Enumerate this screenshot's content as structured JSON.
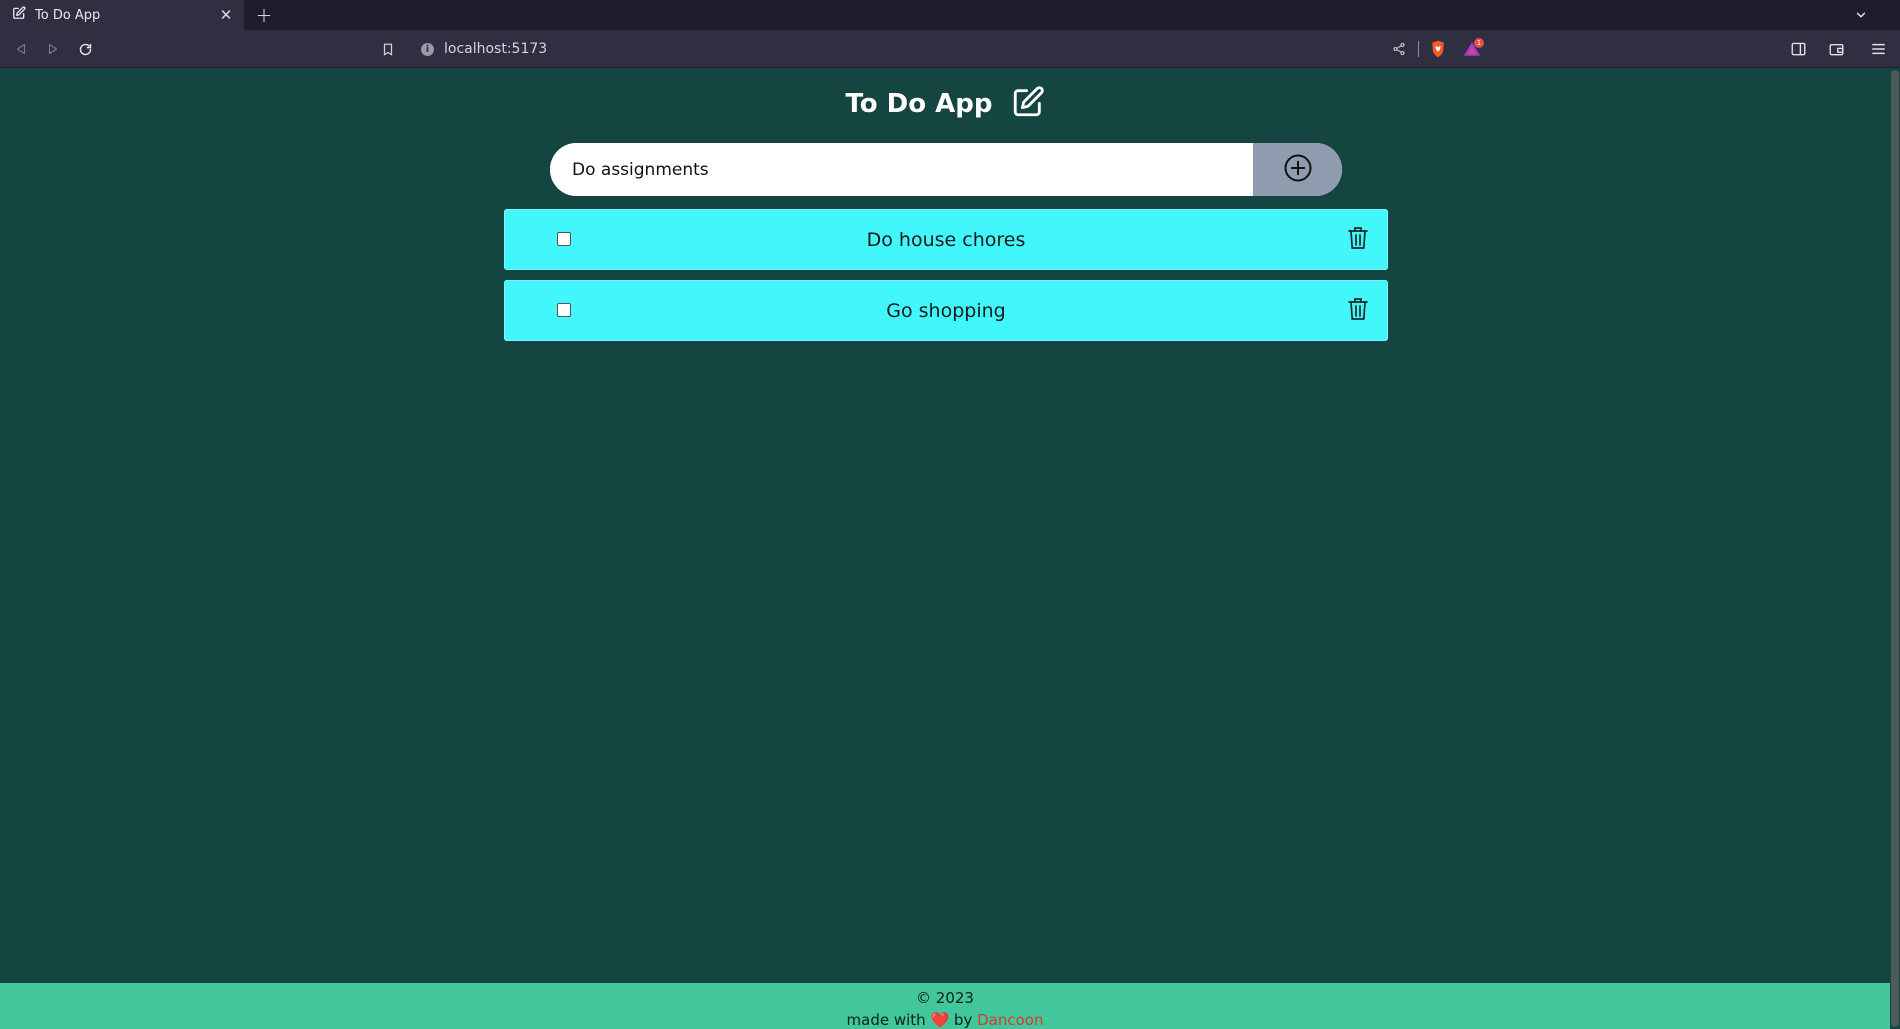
{
  "browser": {
    "tab_title": "To Do App",
    "tab_close": "✕",
    "new_tab": "+",
    "url": "localhost:5173",
    "notification_count": "1"
  },
  "app": {
    "title": "To Do App",
    "input": {
      "value": "Do assignments",
      "placeholder": ""
    },
    "todos": [
      {
        "text": "Do house chores",
        "done": false
      },
      {
        "text": "Go shopping",
        "done": false
      }
    ]
  },
  "footer": {
    "copyright": "© 2023",
    "made_with": "made with",
    "by": "by",
    "author": "Dancoon"
  },
  "colors": {
    "page_bg": "#144540",
    "item_bg": "#42f7fb",
    "add_button_bg": "#8f9cb0",
    "footer_bg": "#42c69c",
    "author_link": "#d93b2b"
  }
}
